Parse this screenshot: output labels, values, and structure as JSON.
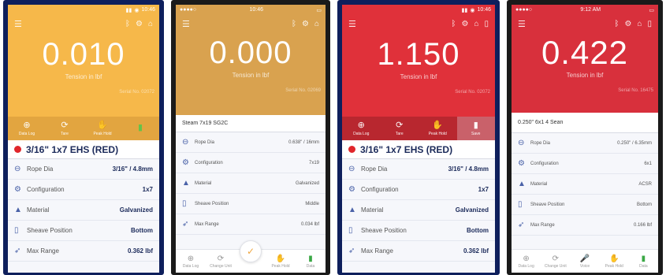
{
  "phones": [
    {
      "status_time": "10:46",
      "reading": "0.010",
      "units": "Tension in lbf",
      "serial": "Serial No. 02072",
      "actions": [
        {
          "glyph": "⊕",
          "label": "Data Log"
        },
        {
          "glyph": "⟳",
          "label": "Tare"
        },
        {
          "glyph": "✋",
          "label": "Peak Hold"
        },
        {
          "glyph": "▮",
          "label": ""
        }
      ],
      "rope_title": "3/16\" 1x7 EHS (RED)",
      "rows": [
        {
          "label": "Rope Dia",
          "value": "3/16\" / 4.8mm"
        },
        {
          "label": "Configuration",
          "value": "1x7"
        },
        {
          "label": "Material",
          "value": "Galvanized"
        },
        {
          "label": "Sheave Position",
          "value": "Bottom"
        },
        {
          "label": "Max Range",
          "value": "0.362 lbf"
        }
      ]
    },
    {
      "status_time": "10:46",
      "reading": "0.000",
      "units": "Tension in lbf",
      "serial": "Serial No. 02069",
      "rope_title": "Steam 7x19 SG2C",
      "rows": [
        {
          "label": "Rope Dia",
          "value": "0.638\" / 16mm"
        },
        {
          "label": "Configuration",
          "value": "7x19"
        },
        {
          "label": "Material",
          "value": "Galvanized"
        },
        {
          "label": "Sheave Position",
          "value": "Middle"
        },
        {
          "label": "Max Range",
          "value": "0.034 lbf"
        }
      ],
      "tabs": [
        {
          "glyph": "⊕",
          "label": "Data Log"
        },
        {
          "glyph": "⟳",
          "label": "Change Unit"
        },
        {
          "glyph": "✋",
          "label": "Peak Hold"
        },
        {
          "glyph": "▮",
          "label": "Data"
        }
      ]
    },
    {
      "status_time": "10:46",
      "reading": "1.150",
      "units": "Tension in lbf",
      "serial": "Serial No. 02072",
      "actions": [
        {
          "glyph": "⊕",
          "label": "Data Log"
        },
        {
          "glyph": "⟳",
          "label": "Tare"
        },
        {
          "glyph": "✋",
          "label": "Peak Hold"
        },
        {
          "glyph": "▮",
          "label": "Save"
        }
      ],
      "rope_title": "3/16\" 1x7 EHS (RED)",
      "rows": [
        {
          "label": "Rope Dia",
          "value": "3/16\" / 4.8mm"
        },
        {
          "label": "Configuration",
          "value": "1x7"
        },
        {
          "label": "Material",
          "value": "Galvanized"
        },
        {
          "label": "Sheave Position",
          "value": "Bottom"
        },
        {
          "label": "Max Range",
          "value": "0.362 lbf"
        }
      ]
    },
    {
      "status_time": "9:12 AM",
      "reading": "0.422",
      "units": "Tension in lbf",
      "serial": "Serial No. 16475",
      "rope_title": "0.250\" 6x1 4 Sean",
      "rows": [
        {
          "label": "Rope Dia",
          "value": "0.250\" / 6.35mm"
        },
        {
          "label": "Configuration",
          "value": "6x1"
        },
        {
          "label": "Material",
          "value": "ACSR"
        },
        {
          "label": "Sheave Position",
          "value": "Bottom"
        },
        {
          "label": "Max Range",
          "value": "0.166 lbf"
        }
      ],
      "tabs": [
        {
          "glyph": "⊕",
          "label": "Data Log"
        },
        {
          "glyph": "⟳",
          "label": "Change Unit"
        },
        {
          "glyph": "🎤",
          "label": "Voice"
        },
        {
          "glyph": "✋",
          "label": "Peak Hold"
        },
        {
          "glyph": "▮",
          "label": "Data"
        }
      ]
    }
  ],
  "colors": {
    "orange": "#f6b84a",
    "tan": "#d9a24f",
    "red": "#e0313a",
    "crimson": "#d8303c",
    "navy": "#0e1f5c",
    "bg": "#f6f7fb",
    "accent_blue": "#4a62a8"
  },
  "icons": {
    "menu": "hamburger-icon",
    "header_icons": [
      "bluetooth-icon",
      "settings-icon",
      "lock-icon",
      "battery-icon"
    ],
    "row_icons": [
      "rope-diameter-icon",
      "configuration-gear-icon",
      "material-icon",
      "sheave-position-icon",
      "range-icon"
    ]
  }
}
